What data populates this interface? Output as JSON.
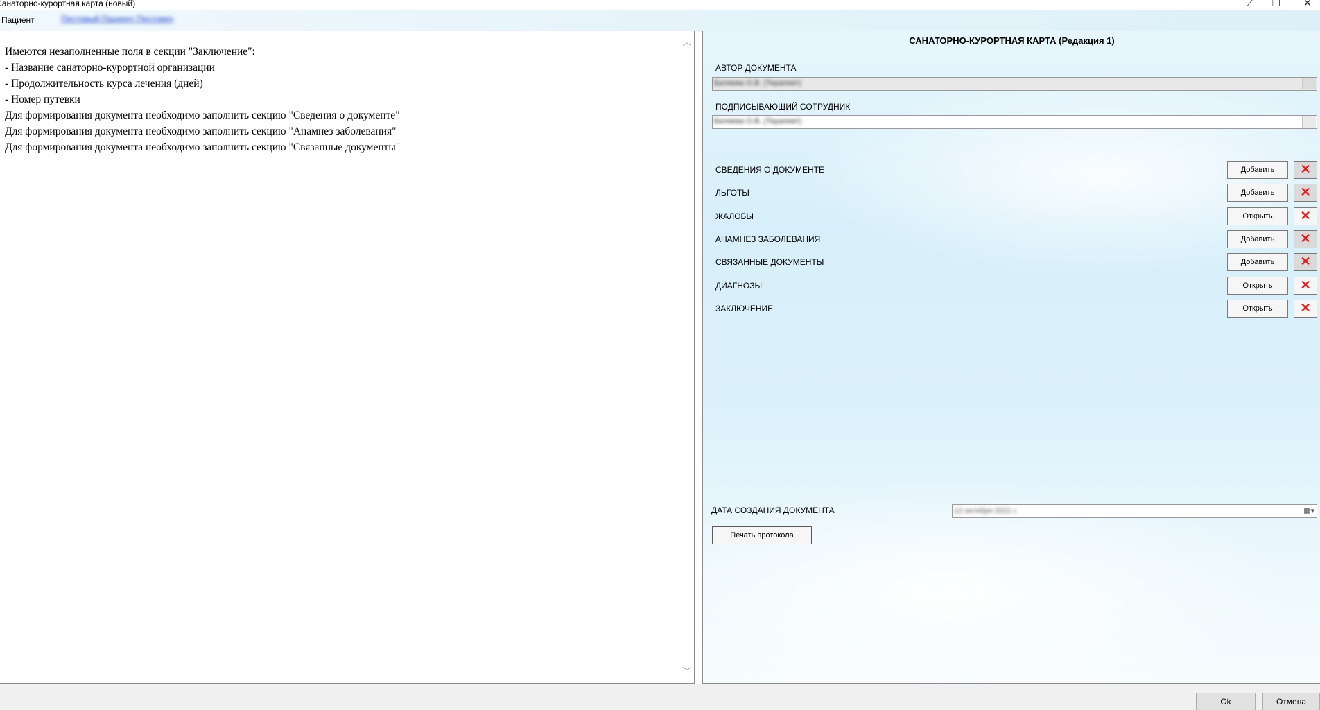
{
  "window": {
    "title": "Санаторно-курортная карта (новый)",
    "minimize_icon": "minimize-icon",
    "restore_icon": "restore-icon",
    "close_icon": "close-icon"
  },
  "patient": {
    "label": "Пациент",
    "name": "Пестовый Пациент Пестович"
  },
  "messages": [
    "Имеются незаполненные поля в секции \"Заключение\":",
    "- Название санаторно-курортной организации",
    "- Продолжительность курса лечения (дней)",
    "- Номер путевки",
    "Для формирования документа необходимо заполнить секцию \"Сведения о документе\"",
    "Для формирования документа необходимо заполнить секцию \"Анамнез заболевания\"",
    "Для формирования документа необходимо заполнить секцию \"Связанные документы\""
  ],
  "card": {
    "title": "САНАТОРНО-КУРОРТНАЯ КАРТА  (Редакция 1)",
    "author_label": "АВТОР ДОКУМЕНТА",
    "author_value": "Беляева О.В. (Терапевт)",
    "signer_label": "ПОДПИСЫВАЮЩИЙ СОТРУДНИК",
    "signer_value": "Беляева О.В. (Терапевт)",
    "signer_button": "...",
    "sections": [
      {
        "label": "СВЕДЕНИЯ О ДОКУМЕНТЕ",
        "button": "Добавить",
        "delete_enabled": false
      },
      {
        "label": "ЛЬГОТЫ",
        "button": "Добавить",
        "delete_enabled": false
      },
      {
        "label": "ЖАЛОБЫ",
        "button": "Открыть",
        "delete_enabled": true
      },
      {
        "label": "АНАМНЕЗ ЗАБОЛЕВАНИЯ",
        "button": "Добавить",
        "delete_enabled": false
      },
      {
        "label": "СВЯЗАННЫЕ ДОКУМЕНТЫ",
        "button": "Добавить",
        "delete_enabled": false
      },
      {
        "label": "ДИАГНОЗЫ",
        "button": "Открыть",
        "delete_enabled": true
      },
      {
        "label": "ЗАКЛЮЧЕНИЕ",
        "button": "Открыть",
        "delete_enabled": true
      }
    ],
    "delete_symbol": "✕",
    "date_label": "ДАТА СОЗДАНИЯ ДОКУМЕНТА",
    "date_value": "12 октября 2021 г.",
    "date_icon": "▦▾",
    "print_button": "Печать протокола"
  },
  "footer": {
    "ok": "Ok",
    "cancel": "Отмена"
  },
  "colors": {
    "delete_icon": "#e02020",
    "panel_bg": "#d7effa",
    "link": "#1a3fd0"
  }
}
